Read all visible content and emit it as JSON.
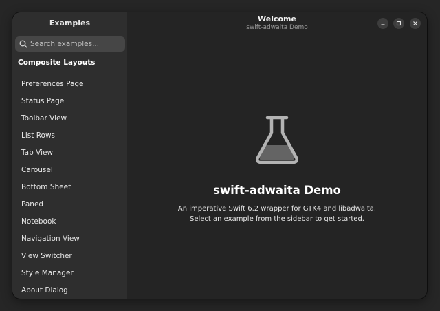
{
  "sidebar": {
    "title": "Examples",
    "search_placeholder": "Search examples...",
    "section_header": "Composite Layouts",
    "items": [
      {
        "label": "Preferences Page"
      },
      {
        "label": "Status Page"
      },
      {
        "label": "Toolbar View"
      },
      {
        "label": "List Rows"
      },
      {
        "label": "Tab View"
      },
      {
        "label": "Carousel"
      },
      {
        "label": "Bottom Sheet"
      },
      {
        "label": "Paned"
      },
      {
        "label": "Notebook"
      },
      {
        "label": "Navigation View"
      },
      {
        "label": "View Switcher"
      },
      {
        "label": "Style Manager"
      },
      {
        "label": "About Dialog"
      }
    ]
  },
  "header": {
    "title": "Welcome",
    "subtitle": "swift-adwaita Demo"
  },
  "status": {
    "icon": "flask-icon",
    "title": "swift-adwaita Demo",
    "description_line1": "An imperative Swift 6.2 wrapper for GTK4 and libadwaita.",
    "description_line2": "Select an example from the sidebar to get started."
  },
  "window_controls": [
    "minimize-icon",
    "maximize-icon",
    "close-icon"
  ]
}
